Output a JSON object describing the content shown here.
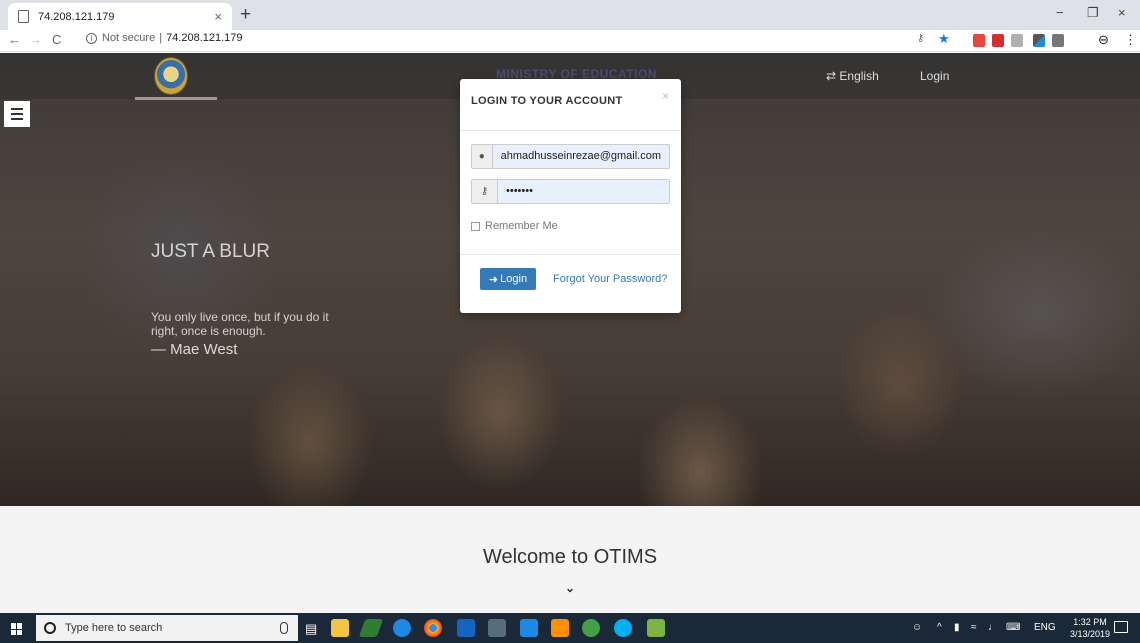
{
  "browser": {
    "tab_title": "74.208.121.179",
    "tab_close": "×",
    "new_tab": "+",
    "win_minimize": "−",
    "win_restore": "❐",
    "win_close": "×",
    "nav_back": "←",
    "nav_forward": "→",
    "nav_reload": "C",
    "security_label": "Not secure",
    "separator": "|",
    "url": "74.208.121.179",
    "profile_icon": "⊖",
    "menu_icon": "⋮"
  },
  "header": {
    "ministry": "MINISTRY OF EDUCATION",
    "language": "English",
    "login": "Login"
  },
  "hero": {
    "title": "JUST A BLUR",
    "quote": "You only live once, but if you do it right, once is enough.",
    "author": "— Mae West"
  },
  "modal": {
    "title": "LOGIN TO YOUR ACCOUNT",
    "close": "×",
    "email_value": "ahmadhusseinrezae@gmail.com",
    "password_value": "•••••••",
    "remember_label": "Remember Me",
    "login_button": "Login",
    "forgot_link": "Forgot Your Password?"
  },
  "main": {
    "welcome": "Welcome to OTIMS",
    "chevron": "⌄"
  },
  "taskbar": {
    "search_placeholder": "Type here to search",
    "language_indicator": "ENG",
    "time": "1:32 PM",
    "date": "3/13/2019"
  }
}
